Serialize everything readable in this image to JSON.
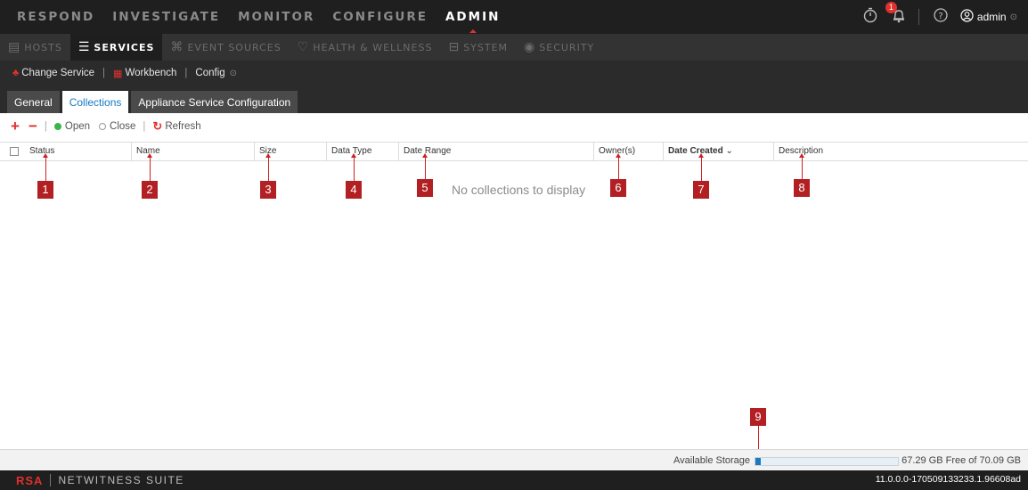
{
  "topnav": {
    "items": [
      "RESPOND",
      "INVESTIGATE",
      "MONITOR",
      "CONFIGURE",
      "ADMIN"
    ],
    "notification_count": "1",
    "user": "admin"
  },
  "subnav": {
    "items": [
      "HOSTS",
      "SERVICES",
      "EVENT SOURCES",
      "HEALTH & WELLNESS",
      "SYSTEM",
      "SECURITY"
    ]
  },
  "servicebar": {
    "change_service": "Change Service",
    "workbench": "Workbench",
    "config": "Config"
  },
  "tabs": [
    "General",
    "Collections",
    "Appliance Service Configuration"
  ],
  "toolbar": {
    "add": "+",
    "remove": "−",
    "open": "Open",
    "close": "Close",
    "refresh": "Refresh"
  },
  "table": {
    "columns": [
      "Status",
      "Name",
      "Size",
      "Data Type",
      "Date Range",
      "Owner(s)",
      "Date Created",
      "Description"
    ],
    "empty_message": "No collections to display"
  },
  "callouts": [
    "1",
    "2",
    "3",
    "4",
    "5",
    "6",
    "7",
    "8",
    "9"
  ],
  "storage": {
    "label": "Available Storage",
    "free_text": "67.29 GB Free of 70.09 GB",
    "used_fraction": 0.04
  },
  "footer": {
    "brand": "RSA",
    "product": "NETWITNESS SUITE",
    "version": "11.0.0.0-170509133233.1.96608ad"
  },
  "colors": {
    "accent_red": "#e0312d",
    "link_blue": "#1479c4",
    "open_green": "#39b54a"
  }
}
